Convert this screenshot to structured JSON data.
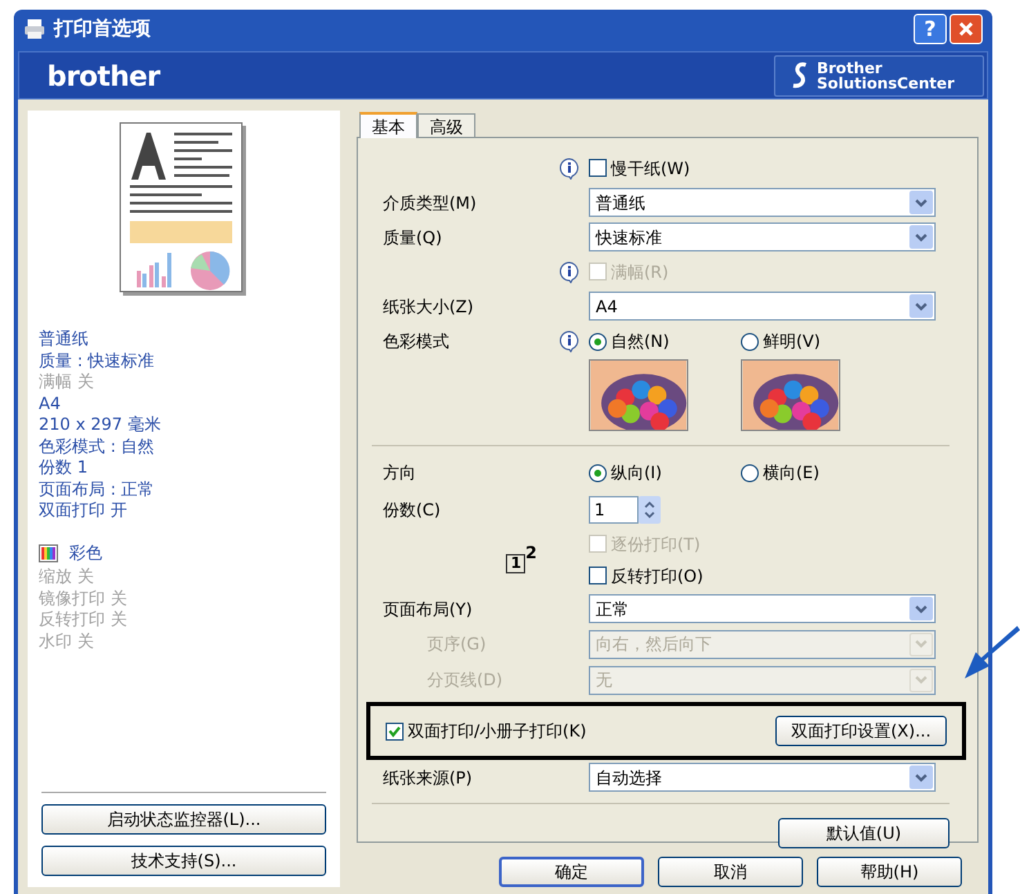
{
  "window": {
    "title": "打印首选项",
    "help_button": "?"
  },
  "brand": {
    "logo": "brother",
    "solutions_button": [
      "Brother",
      "SolutionsCenter"
    ]
  },
  "preview": {
    "summary": [
      {
        "text": "普通纸",
        "disabled": false
      },
      {
        "text": "质量 : 快速标准",
        "disabled": false
      },
      {
        "text": "满幅 关",
        "disabled": true
      },
      {
        "text": "A4",
        "disabled": false
      },
      {
        "text": "210 x 297 毫米",
        "disabled": false
      },
      {
        "text": "色彩模式 : 自然",
        "disabled": false
      },
      {
        "text": "份数 1",
        "disabled": false
      },
      {
        "text": "页面布局 : 正常",
        "disabled": false
      },
      {
        "text": "双面打印 开",
        "disabled": false
      }
    ],
    "extra": [
      {
        "text": "彩色",
        "kind": "color",
        "disabled": false
      },
      {
        "text": "缩放 关",
        "kind": "text",
        "disabled": true
      },
      {
        "text": "镜像打印 关",
        "kind": "text",
        "disabled": true
      },
      {
        "text": "反转打印 关",
        "kind": "text",
        "disabled": true
      },
      {
        "text": "水印 关",
        "kind": "text",
        "disabled": true
      }
    ]
  },
  "left_buttons": [
    "启动状态监控器(L)...",
    "技术支持(S)..."
  ],
  "tabs": [
    {
      "label": "基本",
      "selected": true
    },
    {
      "label": "高级",
      "selected": false
    }
  ],
  "settings": [
    {
      "kind": "checkbox",
      "label": "慢干纸(W)",
      "checked": false,
      "disabled": false,
      "info": true
    },
    {
      "kind": "select",
      "label": "介质类型(M)",
      "value": "普通纸",
      "disabled": false
    },
    {
      "kind": "select",
      "label": "质量(Q)",
      "value": "快速标准",
      "disabled": false
    },
    {
      "kind": "checkbox",
      "label": "满幅(R)",
      "checked": false,
      "disabled": true,
      "info": true
    },
    {
      "kind": "select",
      "label": "纸张大小(Z)",
      "value": "A4",
      "disabled": false
    },
    {
      "kind": "radio",
      "label": "色彩模式",
      "info": true,
      "pictures": true,
      "options": [
        {
          "label": "自然(N)",
          "selected": true
        },
        {
          "label": "鲜明(V)",
          "selected": false
        }
      ]
    },
    {
      "kind": "separator"
    },
    {
      "kind": "radio",
      "label": "方向",
      "info": false,
      "pictures": false,
      "options": [
        {
          "label": "纵向(I)",
          "selected": true
        },
        {
          "label": "横向(E)",
          "selected": false
        }
      ]
    },
    {
      "kind": "spin",
      "label": "份数(C)",
      "value": "1"
    },
    {
      "kind": "collate",
      "digits": [
        "1",
        "2"
      ],
      "checks": [
        {
          "label": "逐份打印(T)",
          "checked": false,
          "disabled": true
        },
        {
          "label": "反转打印(O)",
          "checked": false,
          "disabled": false
        }
      ]
    },
    {
      "kind": "select",
      "label": "页面布局(Y)",
      "value": "正常",
      "disabled": false,
      "children": [
        {
          "kind": "select",
          "label": "页序(G)",
          "value": "向右，然后向下",
          "disabled": true
        },
        {
          "kind": "select",
          "label": "分页线(D)",
          "value": "无",
          "disabled": true
        }
      ]
    },
    {
      "kind": "duplex",
      "label": "双面打印/小册子打印(K)",
      "checked": true,
      "button": "双面打印设置(X)...",
      "highlighted": true
    },
    {
      "kind": "select",
      "label": "纸张来源(P)",
      "value": "自动选择",
      "disabled": false
    },
    {
      "kind": "separator"
    },
    {
      "kind": "button",
      "label": "默认值(U)"
    }
  ],
  "footer_buttons": [
    {
      "label": "确定",
      "default": true
    },
    {
      "label": "取消",
      "default": false
    },
    {
      "label": "帮助(H)",
      "default": false
    }
  ]
}
